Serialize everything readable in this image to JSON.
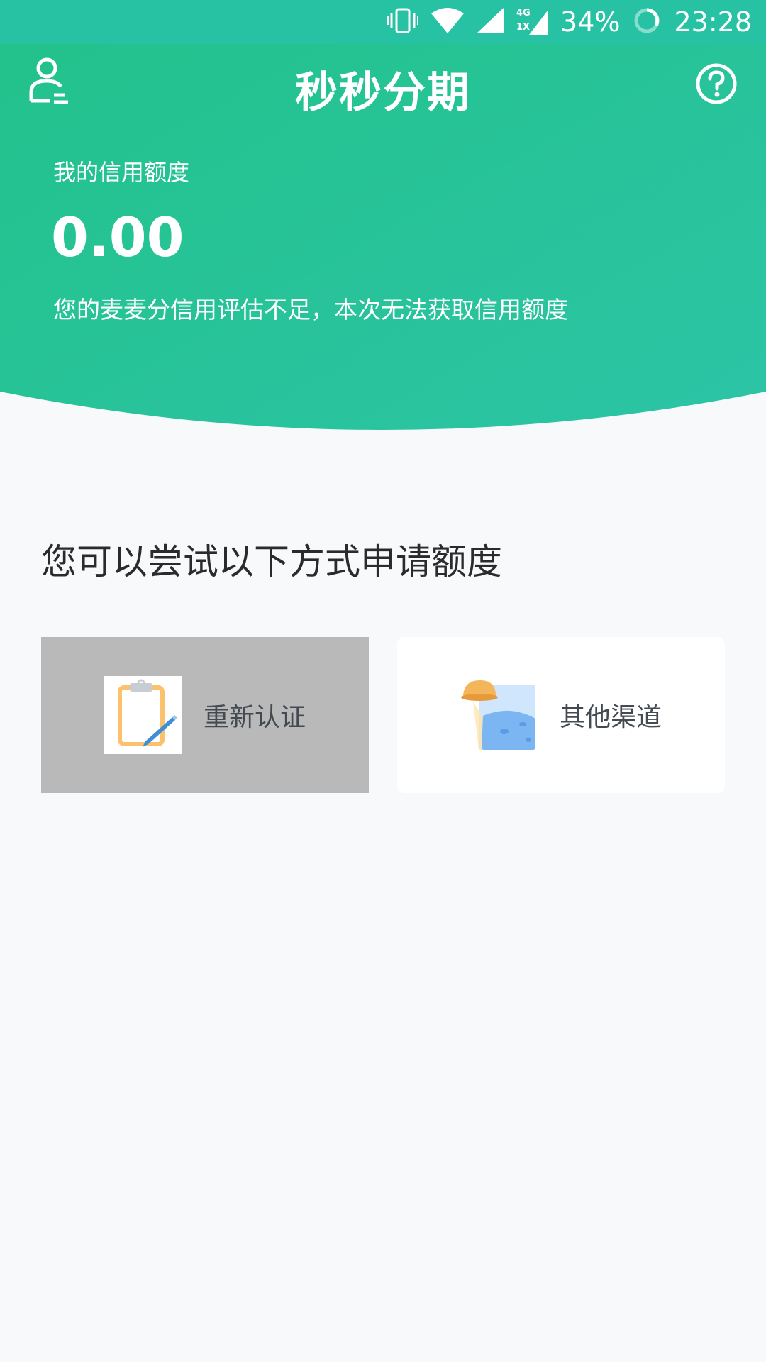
{
  "status_bar": {
    "battery": "34%",
    "time": "23:28",
    "network": "4G",
    "network_sub": "1X"
  },
  "header": {
    "title": "秒秒分期"
  },
  "credit": {
    "label": "我的信用额度",
    "amount": "0.00",
    "note": "您的麦麦分信用评估不足，本次无法获取信用额度"
  },
  "section": {
    "title": "您可以尝试以下方式申请额度"
  },
  "options": [
    {
      "label": "重新认证",
      "icon": "clipboard-icon"
    },
    {
      "label": "其他渠道",
      "icon": "ufo-planet-icon"
    }
  ],
  "colors": {
    "primary_green": "#26c2a3",
    "background": "#f7f9fb",
    "card_pressed": "#b9b9b9"
  }
}
